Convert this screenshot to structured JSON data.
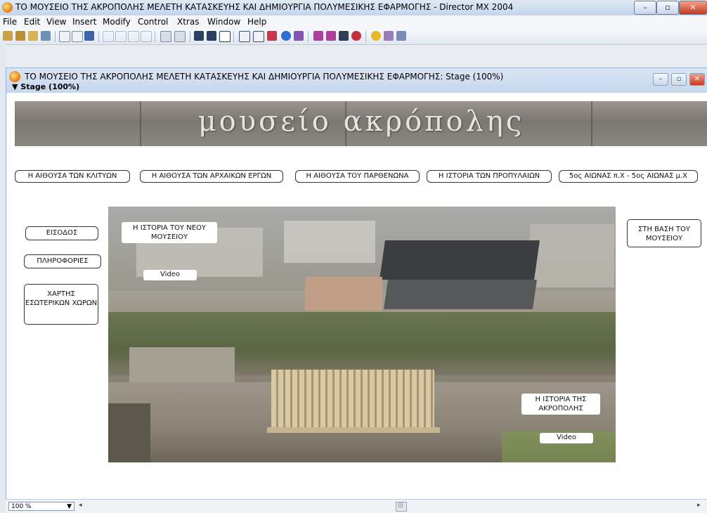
{
  "window": {
    "title": "ΤΟ ΜΟΥΣΕΙΟ ΤΗΣ ΑΚΡΟΠΟΛΗΣ ΜΕΛΕΤΗ ΚΑΤΑΣΚΕΥΗΣ ΚΑΙ ΔΗΜΙΟΥΡΓΙΑ ΠΟΛΥΜΕΣΙΚΗΣ ΕΦΑΡΜΟΓΗΣ - Director MX 2004",
    "minimize": "–",
    "maximize": "▫",
    "close": "✕"
  },
  "menu": [
    "File",
    "Edit",
    "View",
    "Insert",
    "Modify",
    "Control",
    "Xtras",
    "Window",
    "Help"
  ],
  "stage_window": {
    "title": "ΤΟ ΜΟΥΣΕΙΟ ΤΗΣ ΑΚΡΟΠΟΛΗΣ ΜΕΛΕΤΗ ΚΑΤΑΣΚΕΥΗΣ ΚΑΙ ΔΗΜΙΟΥΡΓΙΑ ΠΟΛΥΜΕΣΙΚΗΣ ΕΦΑΡΜΟΓΗΣ: Stage (100%)",
    "subtitle": "▼ Stage (100%)",
    "minimize": "–",
    "restore": "▫",
    "close": "✕"
  },
  "banner": {
    "text": "μουσείο   ακρόπολης"
  },
  "top_nav": [
    "Η ΑΙΘΟΥΣΑ ΤΩΝ ΚΛΙΤΥΩΝ",
    "Η ΑΙΘΟΥΣΑ ΤΩΝ ΑΡΧΑΙΚΩΝ ΕΡΓΩΝ",
    "Η ΑΙΘΟΥΣΑ ΤΟΥ ΠΑΡΘΕΝΩΝΑ",
    "Η ΙΣΤΟΡΙΑ ΤΩΝ ΠΡΟΠΥΛΑΙΩΝ",
    "5ος ΑΙΩΝΑΣ π.Χ - 5ος ΑΙΩΝΑΣ μ.Χ"
  ],
  "left_nav": {
    "entrance": "ΕΙΣΟΔΟΣ",
    "info": "ΠΛΗΡΟΦΟΡΙΕΣ",
    "map": "ΧΑΡΤΗΣ ΕΣΩΤΕΡΙΚΩΝ ΧΩΡΩΝ"
  },
  "right_nav": {
    "base": "ΣΤΗ ΒΑΣΗ ΤΟΥ ΜΟΥΣΕΙΟΥ"
  },
  "photo_labels": {
    "new_museum_history": "Η ΙΣΤΟΡΙΑ ΤΟΥ ΝΕΟΥ ΜΟΥΣΕΙΟΥ",
    "video_top": "Video",
    "acropolis_history": "Η ΙΣΤΟΡΙΑ ΤΗΣ ΑΚΡΟΠΟΛΗΣ",
    "video_bottom": "Video"
  },
  "statusbar": {
    "zoom": "100 %",
    "zoom_arrow": "▼",
    "left_arrow": "◂",
    "right_arrow": "▸",
    "thumb": "|||"
  },
  "colors": {
    "titlebar": "#c3d6ec",
    "stage_bg": "#ffffff",
    "close_btn": "#c8381e"
  }
}
